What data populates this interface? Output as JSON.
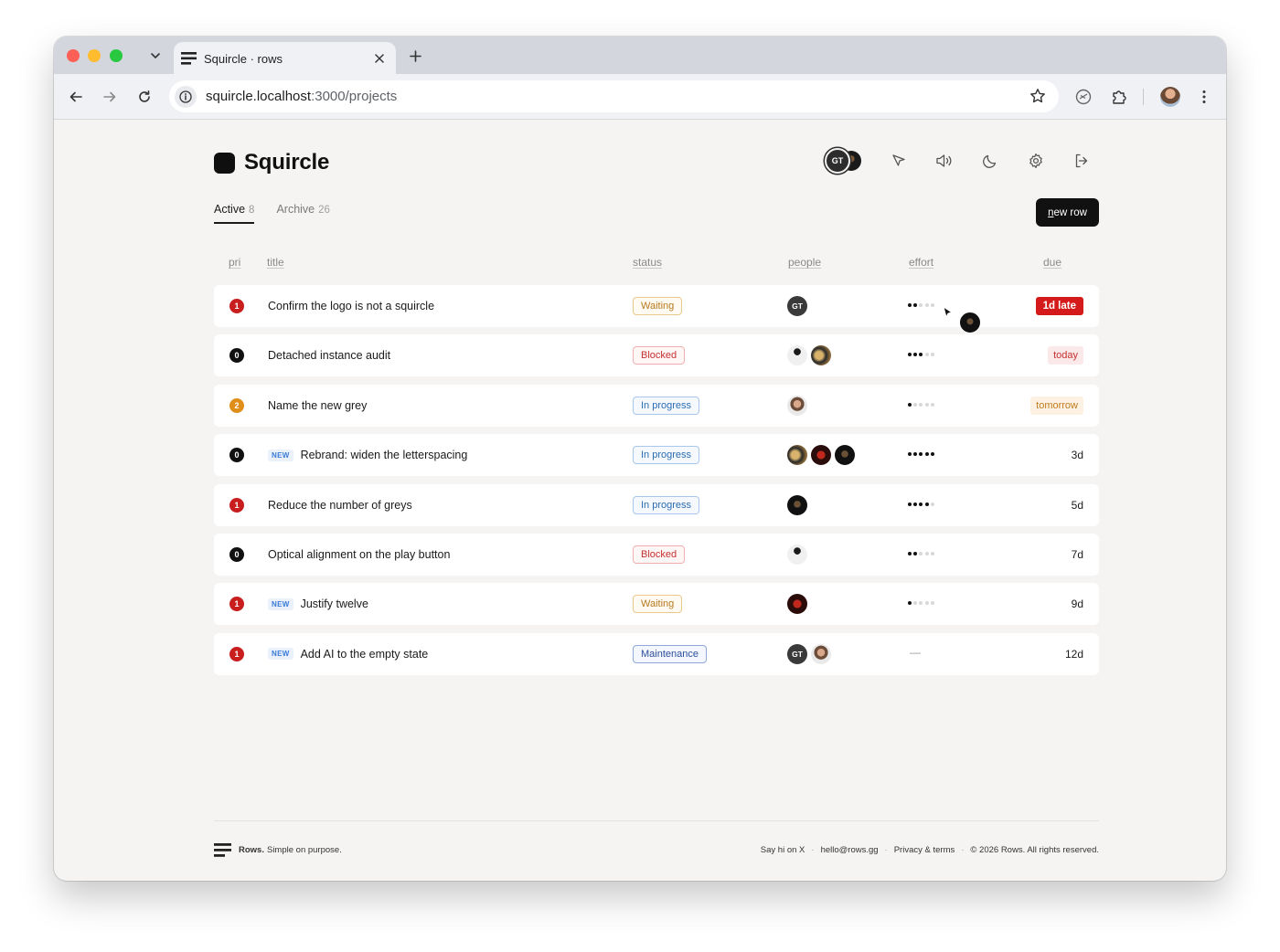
{
  "browser": {
    "tab_title": "Squircle · rows",
    "url_host": "squircle.localhost",
    "url_path": ":3000/projects"
  },
  "app": {
    "name": "Squircle",
    "header_avatar_initials": "GT"
  },
  "tabs": [
    {
      "label": "Active",
      "count": "8"
    },
    {
      "label": "Archive",
      "count": "26"
    }
  ],
  "new_row": {
    "prefix": "n",
    "label": "ew row"
  },
  "columns": {
    "pri": "pri",
    "title": "title",
    "status": "status",
    "people": "people",
    "effort": "effort",
    "due": "due"
  },
  "rows": [
    {
      "pri": "1",
      "new": "",
      "title": "Confirm the logo is not a squircle",
      "status": "Waiting",
      "effort": 2,
      "due": "1d late"
    },
    {
      "pri": "0",
      "new": "",
      "title": "Detached instance audit",
      "status": "Blocked",
      "effort": 3,
      "due": "today"
    },
    {
      "pri": "2",
      "new": "",
      "title": "Name the new grey",
      "status": "In progress",
      "effort": 1,
      "due": "tomorrow"
    },
    {
      "pri": "0",
      "new": "NEW",
      "title": "Rebrand: widen the letterspacing",
      "status": "In progress",
      "effort": 5,
      "due": "3d"
    },
    {
      "pri": "1",
      "new": "",
      "title": "Reduce the number of greys",
      "status": "In progress",
      "effort": 4,
      "due": "5d"
    },
    {
      "pri": "0",
      "new": "",
      "title": "Optical alignment on the play button",
      "status": "Blocked",
      "effort": 2,
      "due": "7d"
    },
    {
      "pri": "1",
      "new": "NEW",
      "title": "Justify twelve",
      "status": "Waiting",
      "effort": 1,
      "due": "9d"
    },
    {
      "pri": "1",
      "new": "NEW",
      "title": "Add AI to the empty state",
      "status": "Maintenance",
      "effort": "—",
      "due": "12d"
    }
  ],
  "people_initials": "GT",
  "footer": {
    "brand": "Rows.",
    "tagline": "Simple on purpose.",
    "links": [
      "Say hi on X",
      "hello@rows.gg",
      "Privacy & terms",
      "© 2026 Rows. All rights reserved."
    ],
    "separator": "·"
  },
  "icons": {
    "header": [
      "cursor-icon",
      "sound-icon",
      "moon-icon",
      "gear-icon",
      "logout-icon"
    ],
    "browser": [
      "back-icon",
      "forward-icon",
      "reload-icon",
      "info-icon",
      "star-icon",
      "extensions-icon",
      "puzzle-icon",
      "menu-icon"
    ]
  },
  "colors": {
    "pri_0": "#111111",
    "pri_1": "#c81e1e",
    "pri_2": "#e08e1a",
    "late": "#d41a1a",
    "accent": "#111111"
  }
}
